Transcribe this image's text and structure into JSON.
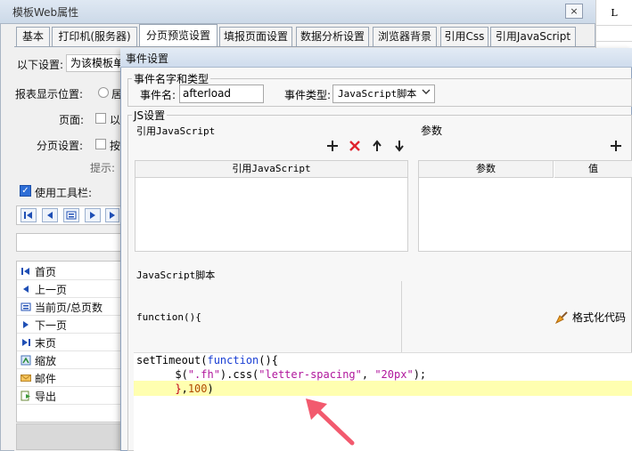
{
  "back_window": {
    "title": "模板Web属性",
    "close_glyph": "×",
    "tabs": [
      "基本",
      "打印机(服务器)",
      "分页预览设置",
      "填报页面设置",
      "数据分析设置",
      "浏览器背景",
      "引用Css",
      "引用JavaScript"
    ],
    "active_tab": "分页预览设置",
    "settings_label": "以下设置:",
    "settings_value": "为该模板单",
    "display_position_label": "报表显示位置:",
    "display_position_option": "居",
    "page_label": "页面:",
    "page_option": "以",
    "pagination_label": "分页设置:",
    "pagination_option": "按",
    "hint_label": "提示:",
    "use_toolbar_label": "使用工具栏:",
    "list_items": [
      {
        "icon": "first-page-icon",
        "label": "首页"
      },
      {
        "icon": "prev-page-icon",
        "label": "上一页"
      },
      {
        "icon": "page-count-icon",
        "label": "当前页/总页数"
      },
      {
        "icon": "next-page-icon",
        "label": "下一页"
      },
      {
        "icon": "last-page-icon",
        "label": "末页"
      },
      {
        "icon": "zoom-icon",
        "label": "缩放"
      },
      {
        "icon": "mail-icon",
        "label": "邮件"
      },
      {
        "icon": "export-icon",
        "label": "导出"
      }
    ]
  },
  "sheet": {
    "column_header": "L"
  },
  "dialog": {
    "title": "事件设置",
    "name_type_group": "事件名字和类型",
    "event_name_label": "事件名:",
    "event_name_value": "afterload",
    "event_type_label": "事件类型:",
    "event_type_value": "JavaScript脚本",
    "js_group": "JS设置",
    "ref_js_label": "引用JavaScript",
    "params_label": "参数",
    "ref_js_column": "引用JavaScript",
    "params_columns": [
      "参数",
      "值"
    ],
    "script_label": "JavaScript脚本",
    "function_header": "function(){",
    "format_button": "格式化代码",
    "toolbar_icons": [
      "add-icon",
      "delete-icon",
      "move-up-icon",
      "move-down-icon"
    ],
    "code": {
      "line1_kw1": "setTimeout(",
      "line1_kw2": "function",
      "line1_rest": "(){",
      "line2_a": "      $(",
      "line2_s1": "\".fh\"",
      "line2_b": ").css(",
      "line2_s2": "\"letter-spacing\"",
      "line2_c": ", ",
      "line2_s3": "\"20px\"",
      "line2_d": ");",
      "line3_a": "      }",
      "line3_b": ",",
      "line3_num": "100",
      "line3_c": ")"
    }
  },
  "colors": {
    "accent": "#2e6ed6",
    "highlight_line": "#ffffb0",
    "arrow": "#f25a6e"
  }
}
